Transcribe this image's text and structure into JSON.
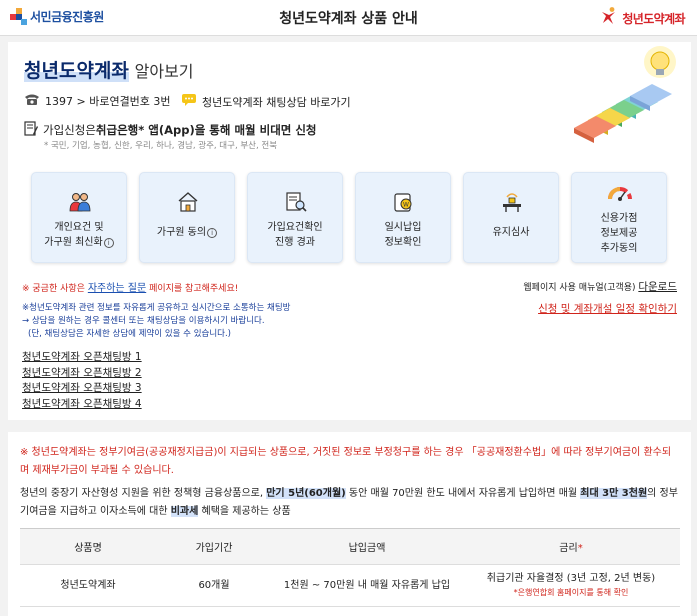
{
  "header": {
    "left_logo_text": "서민금융진흥원",
    "title": "청년도약계좌 상품 안내",
    "right_logo_text": "청년도약계좌"
  },
  "intro": {
    "title_highlight": "청년도약계좌",
    "title_rest": "알아보기",
    "phone_text": "1397 > 바로연결번호 3번",
    "chat_text": "청년도약계좌 채팅상담 바로가기",
    "apply_pre": "가입신청은 ",
    "apply_bold": "취급은행* 앱(App)을 통해 매월 비대면 신청",
    "banks": "* 국민, 기업, 농협, 신한, 우리, 하나, 경남, 광주, 대구, 부산, 전북"
  },
  "steps": [
    {
      "line1": "개인요건 및",
      "line2": "가구원 최신화",
      "info": true,
      "icon": "family-icon"
    },
    {
      "line1": "가구원 동의",
      "line2": "",
      "info": true,
      "icon": "house-icon"
    },
    {
      "line1": "가입요건확인",
      "line2": "진행 경과",
      "info": false,
      "icon": "document-search-icon"
    },
    {
      "line1": "일시납입",
      "line2": "정보확인",
      "info": false,
      "icon": "coin-stack-icon"
    },
    {
      "line1": "유지심사",
      "line2": "",
      "info": false,
      "icon": "review-desk-icon"
    },
    {
      "line1": "신용가점",
      "line2": "정보제공",
      "line3": "추가동의",
      "info": false,
      "icon": "credit-gauge-icon"
    }
  ],
  "help": {
    "faq_pre": "※ 궁금한 사항은 ",
    "faq_link": "자주하는 질문",
    "faq_post": " 페이지를 참고해주세요!",
    "manual_pre": "웹페이지 사용 매뉴얼(고객용) ",
    "manual_link": "다운로드",
    "notice_line1": "※청년도약계좌 관련 정보를 자유롭게 공유하고 실시간으로 소통하는 채팅방",
    "notice_line2": "→ 상담을 원하는 경우 콜센터 또는 채팅상담을 이용하시기 바랍니다.",
    "notice_line3": "(단, 채팅상담은 자세한 상담에 제약이 있을 수 있습니다.)",
    "schedule_link": "신청 및 계좌개설 일정 확인하기"
  },
  "open_chats": [
    "청년도약계좌 오픈채팅방 1",
    "청년도약계좌 오픈채팅방 2",
    "청년도약계좌 오픈채팅방 3",
    "청년도약계좌 오픈채팅방 4"
  ],
  "product": {
    "warning": "※ 청년도약계좌는 정부기여금(공공재정지급금)이 지급되는 상품으로, 거짓된 정보로 부정청구를 하는 경우 「공공재정환수법」에 따라 정부기여금이 환수되며 제재부가금이 부과될 수 있습니다.",
    "desc_a": "청년의 중장기 자산형성 지원을 위한 정책형 금융상품으로, ",
    "desc_b": "만기 5년(60개월)",
    "desc_c": " 동안 매월 70만원 한도 내에서 자유롭게 납입하면 매월 ",
    "desc_d": "최대 3만 3천원",
    "desc_e": "의 정부기여금을 지급하고 이자소득에 대한 ",
    "desc_f": "비과세",
    "desc_g": " 혜택을 제공하는 상품"
  },
  "table": {
    "headers": [
      "상품명",
      "가입기간",
      "납입금액",
      "금리"
    ],
    "required_mark": "*",
    "row": {
      "name": "청년도약계좌",
      "period": "60개월",
      "amount": "1천원 ~ 70만원 내 매월 자유롭게 납입",
      "rate": "취급기관 자율결정 (3년 고정, 2년 변동)",
      "rate_note": "*은행연합회 홈페이지를 통해 확인"
    }
  },
  "colors": {
    "brand_blue": "#1d4fa0",
    "alert_red": "#d0241b",
    "step_bg": "#e9f2fc",
    "highlight": "#d3e2f9"
  }
}
